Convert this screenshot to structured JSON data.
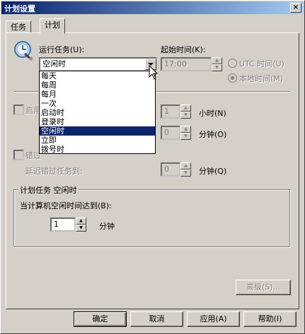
{
  "window": {
    "title": "计划设置",
    "close_label": "×"
  },
  "tabs": [
    {
      "label": "任务"
    },
    {
      "label": "计划"
    }
  ],
  "run_task": {
    "label": "运行任务(U):",
    "selected": "空闲时",
    "options": [
      "每天",
      "每周",
      "每月",
      "一次",
      "启动时",
      "登录时",
      "空闲时",
      "立即",
      "拨号时"
    ],
    "highlighted_index": 6
  },
  "start_time": {
    "label": "起始时间(K):",
    "value": "17:00",
    "utc_label": "UTC 时间(U)",
    "local_label": "本地时间(M)",
    "selected_mode": "local"
  },
  "repeat": {
    "check_label_visible": "启用",
    "every_value": "1",
    "hours_label": "小时(N)",
    "minutes_value": "0",
    "minutes_label": "分钟(O)"
  },
  "missed": {
    "check_label_visible": "错过",
    "delay_label": "延迟错过任务到:",
    "delay_value": "0",
    "minutes_label": "分钟(Q)"
  },
  "idle_group": {
    "title": "计划任务 空闲时",
    "prompt": "当计算机空闲时间达到(B):",
    "value": "1",
    "unit": "分钟"
  },
  "advanced_button": "高级(S)...",
  "footer": {
    "ok": "确定",
    "cancel": "取消",
    "apply": "应用(A)",
    "help": "帮助(I)"
  }
}
